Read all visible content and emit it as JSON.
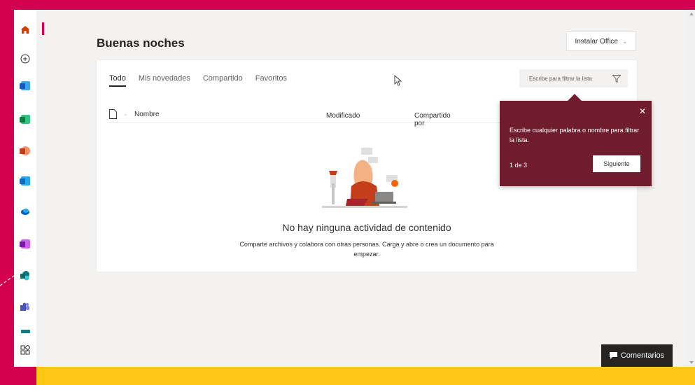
{
  "header": {
    "greeting": "Buenas noches",
    "install_button": "Instalar Office"
  },
  "tabs": [
    {
      "label": "Todo",
      "active": true
    },
    {
      "label": "Mis novedades"
    },
    {
      "label": "Compartido"
    },
    {
      "label": "Favoritos"
    }
  ],
  "filter": {
    "placeholder": "Escribe para filtrar la lista"
  },
  "columns": {
    "name": "Nombre",
    "modified": "Modificado",
    "shared_by": "Compartido por"
  },
  "empty_state": {
    "title": "No hay ninguna actividad de contenido",
    "subtitle": "Comparte archivos y colabora con otras personas. Carga y abre o crea un documento para empezar."
  },
  "teaching_bubble": {
    "message": "Escribe cualquier palabra o nombre para filtrar la lista.",
    "step": "1 de 3",
    "next_button": "Siguiente"
  },
  "feedback_button": "Comentarios",
  "sidebar": {
    "apps": [
      {
        "name": "Word",
        "color": "#185abd"
      },
      {
        "name": "Excel",
        "color": "#107c41"
      },
      {
        "name": "PowerPoint",
        "color": "#c43e1c"
      },
      {
        "name": "Outlook",
        "color": "#0f6cbd"
      },
      {
        "name": "OneDrive",
        "color": "#0364b8"
      },
      {
        "name": "OneNote",
        "color": "#7719aa"
      },
      {
        "name": "SharePoint",
        "color": "#038387"
      },
      {
        "name": "Teams",
        "color": "#4b53bc"
      },
      {
        "name": "Sway",
        "color": "#0f7b83"
      }
    ]
  },
  "colors": {
    "brand": "#d2004f",
    "teaching_bubble": "#6f1d2e",
    "banner": "#ffc817"
  }
}
